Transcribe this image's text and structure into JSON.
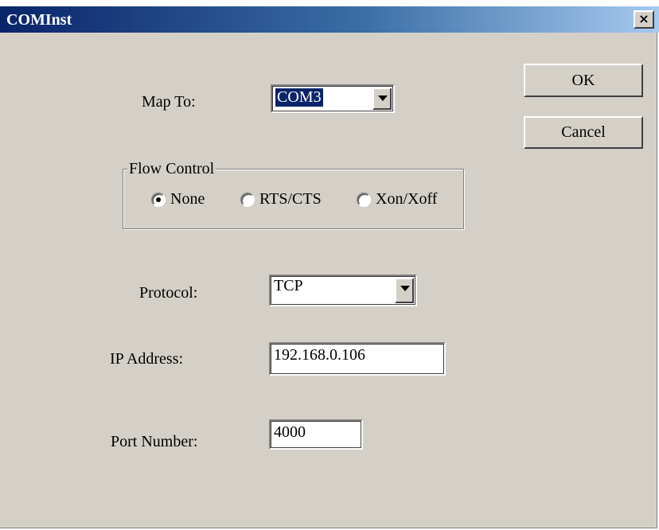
{
  "window": {
    "title": "COMInst",
    "close_glyph": "×"
  },
  "buttons": {
    "ok": "OK",
    "cancel": "Cancel"
  },
  "map_to": {
    "label": "Map To:",
    "value": "COM3"
  },
  "flow_control": {
    "legend": "Flow Control",
    "options": [
      {
        "label": "None",
        "selected": true
      },
      {
        "label": "RTS/CTS",
        "selected": false
      },
      {
        "label": "Xon/Xoff",
        "selected": false
      }
    ]
  },
  "protocol": {
    "label": "Protocol:",
    "value": "TCP"
  },
  "ip_address": {
    "label": "IP Address:",
    "value": "192.168.0.106"
  },
  "port_number": {
    "label": "Port Number:",
    "value": "4000"
  }
}
